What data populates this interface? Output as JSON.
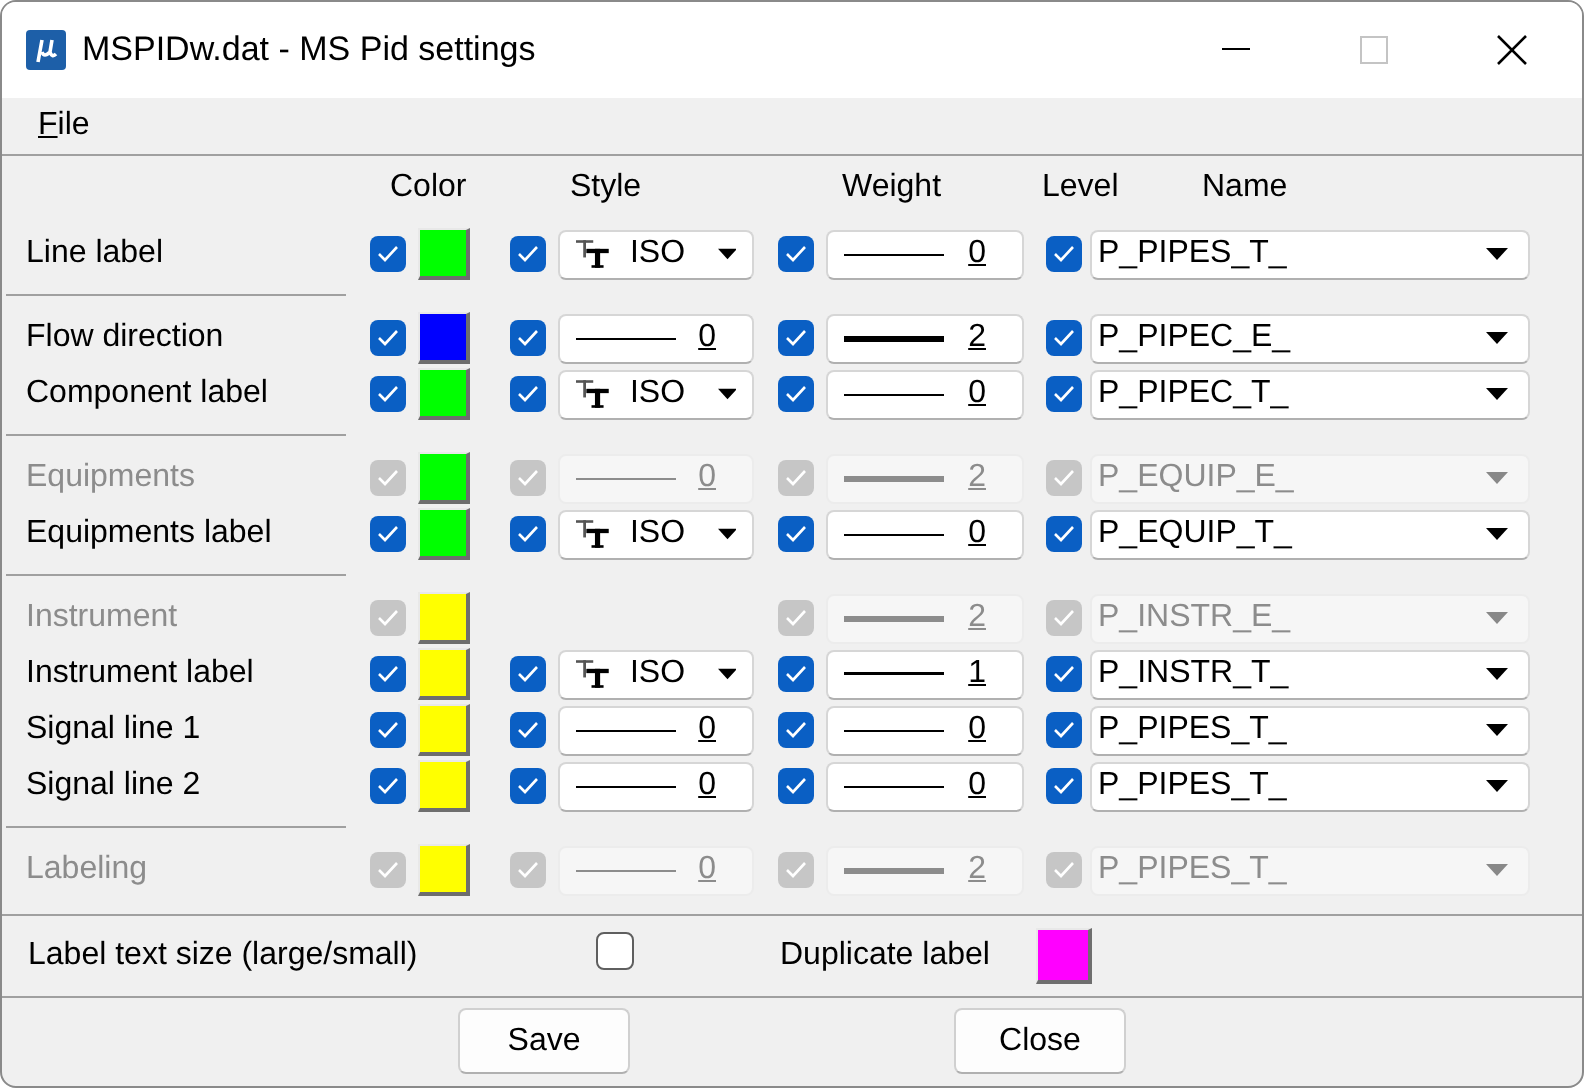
{
  "window": {
    "title": "MSPIDw.dat - MS Pid settings",
    "maximize_enabled": false
  },
  "menu": [
    {
      "label": "File",
      "mnemonic": true
    }
  ],
  "columns": [
    "Color",
    "Style",
    "Weight",
    "Level",
    "Name"
  ],
  "groups": [
    {
      "rows": [
        {
          "label": "Line label",
          "enabled": true,
          "color": {
            "checked": true,
            "color": "#00ff00"
          },
          "style": {
            "checked": true,
            "kind": "font",
            "value": "ISO"
          },
          "weight": {
            "checked": true,
            "value": "0"
          },
          "name": {
            "checked": true,
            "value": "P_PIPES_T_"
          }
        }
      ]
    },
    {
      "rows": [
        {
          "label": "Flow direction",
          "enabled": true,
          "color": {
            "checked": true,
            "color": "#0000ff"
          },
          "style": {
            "checked": true,
            "kind": "line",
            "value": "0"
          },
          "weight": {
            "checked": true,
            "value": "2"
          },
          "name": {
            "checked": true,
            "value": "P_PIPEC_E_"
          }
        },
        {
          "label": "Component label",
          "enabled": true,
          "color": {
            "checked": true,
            "color": "#00ff00"
          },
          "style": {
            "checked": true,
            "kind": "font",
            "value": "ISO"
          },
          "weight": {
            "checked": true,
            "value": "0"
          },
          "name": {
            "checked": true,
            "value": "P_PIPEC_T_"
          }
        }
      ]
    },
    {
      "rows": [
        {
          "label": "Equipments",
          "enabled": false,
          "color": {
            "checked": true,
            "color": "#00ff00"
          },
          "style": {
            "checked": true,
            "kind": "line",
            "value": "0"
          },
          "weight": {
            "checked": true,
            "value": "2"
          },
          "name": {
            "checked": true,
            "value": "P_EQUIP_E_"
          }
        },
        {
          "label": "Equipments label",
          "enabled": true,
          "color": {
            "checked": true,
            "color": "#00ff00"
          },
          "style": {
            "checked": true,
            "kind": "font",
            "value": "ISO"
          },
          "weight": {
            "checked": true,
            "value": "0"
          },
          "name": {
            "checked": true,
            "value": "P_EQUIP_T_"
          }
        }
      ]
    },
    {
      "rows": [
        {
          "label": "Instrument",
          "enabled": false,
          "color": {
            "checked": true,
            "color": "#ffff00"
          },
          "weight": {
            "checked": true,
            "value": "2"
          },
          "name": {
            "checked": true,
            "value": "P_INSTR_E_"
          }
        },
        {
          "label": "Instrument label",
          "enabled": true,
          "color": {
            "checked": true,
            "color": "#ffff00"
          },
          "style": {
            "checked": true,
            "kind": "font",
            "value": "ISO"
          },
          "weight": {
            "checked": true,
            "value": "1"
          },
          "name": {
            "checked": true,
            "value": "P_INSTR_T_"
          }
        },
        {
          "label": "Signal line 1",
          "enabled": true,
          "color": {
            "checked": true,
            "color": "#ffff00"
          },
          "style": {
            "checked": true,
            "kind": "line",
            "value": "0"
          },
          "weight": {
            "checked": true,
            "value": "0"
          },
          "name": {
            "checked": true,
            "value": "P_PIPES_T_"
          }
        },
        {
          "label": "Signal line 2",
          "enabled": true,
          "color": {
            "checked": true,
            "color": "#ffff00"
          },
          "style": {
            "checked": true,
            "kind": "line",
            "value": "0"
          },
          "weight": {
            "checked": true,
            "value": "0"
          },
          "name": {
            "checked": true,
            "value": "P_PIPES_T_"
          }
        }
      ]
    },
    {
      "rows": [
        {
          "label": "Labeling",
          "enabled": false,
          "color": {
            "checked": true,
            "color": "#ffff00"
          },
          "style": {
            "checked": true,
            "kind": "line",
            "value": "0"
          },
          "weight": {
            "checked": true,
            "value": "2"
          },
          "name": {
            "checked": true,
            "value": "P_PIPES_T_"
          }
        }
      ]
    }
  ],
  "options": {
    "text_size": {
      "label": "Label text size (large/small)",
      "checked": false
    },
    "duplicate": {
      "label": "Duplicate label",
      "color": "#ff00ff"
    }
  },
  "buttons": [
    "Save",
    "Close"
  ]
}
